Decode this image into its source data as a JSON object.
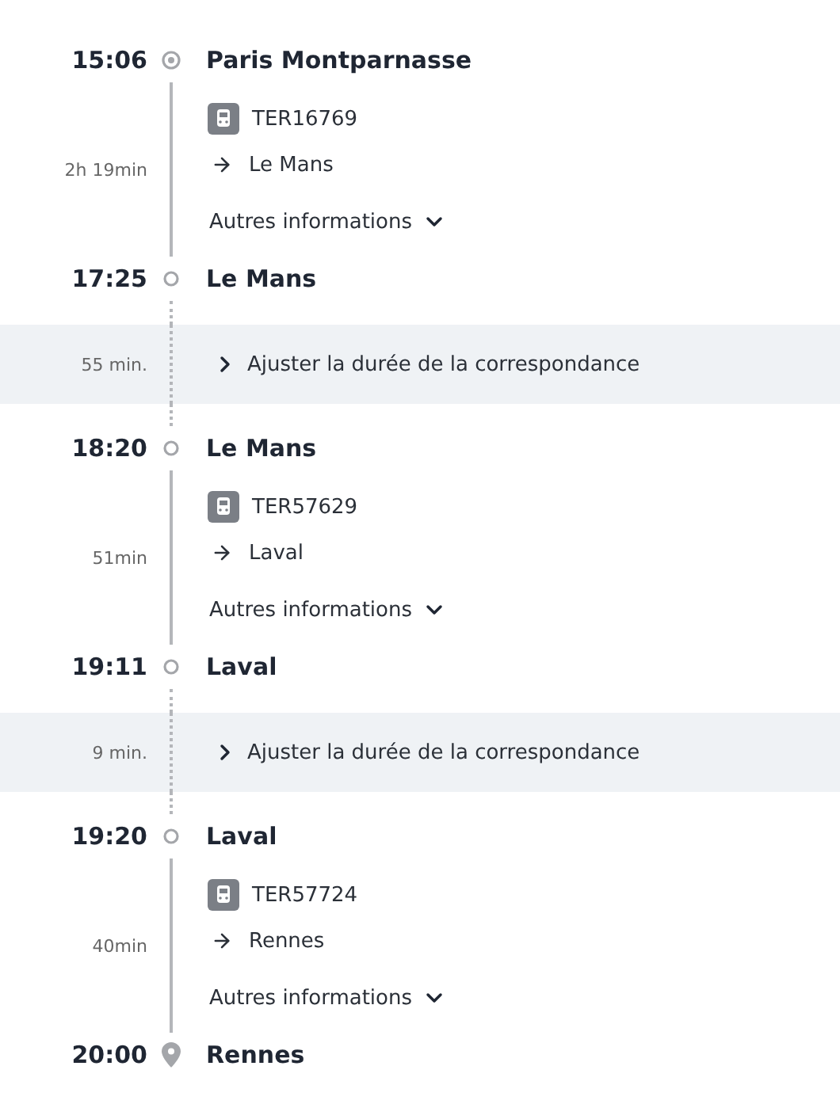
{
  "itinerary": [
    {
      "kind": "origin",
      "time": "15:06",
      "station": "Paris Montparnasse"
    },
    {
      "kind": "leg",
      "duration": "2h 19min",
      "train": "TER16769",
      "direction": "Le Mans",
      "details_label": "Autres informations",
      "details_expanded": false
    },
    {
      "kind": "stop",
      "time": "17:25",
      "station": "Le Mans"
    },
    {
      "kind": "transfer",
      "duration": "55 min.",
      "action": "Ajuster la durée de la correspondance",
      "expanded": false
    },
    {
      "kind": "stop",
      "time": "18:20",
      "station": "Le Mans"
    },
    {
      "kind": "leg",
      "duration": "51min",
      "train": "TER57629",
      "direction": "Laval",
      "details_label": "Autres informations",
      "details_expanded": false
    },
    {
      "kind": "stop",
      "time": "19:11",
      "station": "Laval"
    },
    {
      "kind": "transfer",
      "duration": "9 min.",
      "action": "Ajuster la durée de la correspondance",
      "expanded": false
    },
    {
      "kind": "stop",
      "time": "19:20",
      "station": "Laval"
    },
    {
      "kind": "leg",
      "duration": "40min",
      "train": "TER57724",
      "direction": "Rennes",
      "details_label": "Autres informations",
      "details_expanded": false
    },
    {
      "kind": "destination",
      "time": "20:00",
      "station": "Rennes"
    }
  ]
}
